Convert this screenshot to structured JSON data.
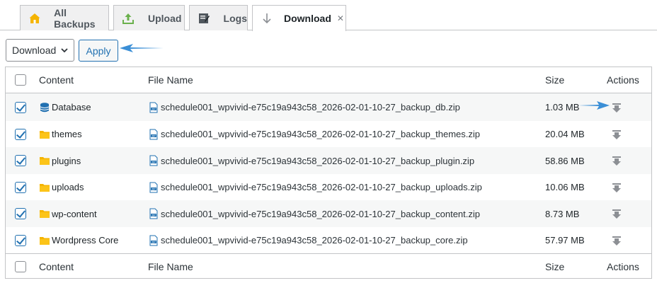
{
  "tabs": [
    {
      "label": "All Backups",
      "icon": "home-icon"
    },
    {
      "label": "Upload",
      "icon": "upload-icon"
    },
    {
      "label": "Logs",
      "icon": "logs-icon"
    },
    {
      "label": "Download",
      "icon": "download-arrow-icon",
      "close": "✕"
    }
  ],
  "toolbar": {
    "select_value": "Download",
    "apply_label": "Apply"
  },
  "table": {
    "columns": {
      "content": "Content",
      "file_name": "File Name",
      "size": "Size",
      "actions": "Actions"
    },
    "rows": [
      {
        "content": "Database",
        "icon": "database-icon",
        "file": "schedule001_wpvivid-e75c19a943c58_2026-02-01-10-27_backup_db.zip",
        "size": "1.03 MB"
      },
      {
        "content": "themes",
        "icon": "folder-icon",
        "file": "schedule001_wpvivid-e75c19a943c58_2026-02-01-10-27_backup_themes.zip",
        "size": "20.04 MB"
      },
      {
        "content": "plugins",
        "icon": "folder-icon",
        "file": "schedule001_wpvivid-e75c19a943c58_2026-02-01-10-27_backup_plugin.zip",
        "size": "58.86 MB"
      },
      {
        "content": "uploads",
        "icon": "folder-icon",
        "file": "schedule001_wpvivid-e75c19a943c58_2026-02-01-10-27_backup_uploads.zip",
        "size": "10.06 MB"
      },
      {
        "content": "wp-content",
        "icon": "folder-icon",
        "file": "schedule001_wpvivid-e75c19a943c58_2026-02-01-10-27_backup_content.zip",
        "size": "8.73 MB"
      },
      {
        "content": "Wordpress Core",
        "icon": "folder-icon",
        "file": "schedule001_wpvivid-e75c19a943c58_2026-02-01-10-27_backup_core.zip",
        "size": "57.97 MB"
      }
    ]
  },
  "colors": {
    "accent": "#2271b1",
    "folder": "#f5b400",
    "annotation_arrow": "#3b8fd6"
  }
}
